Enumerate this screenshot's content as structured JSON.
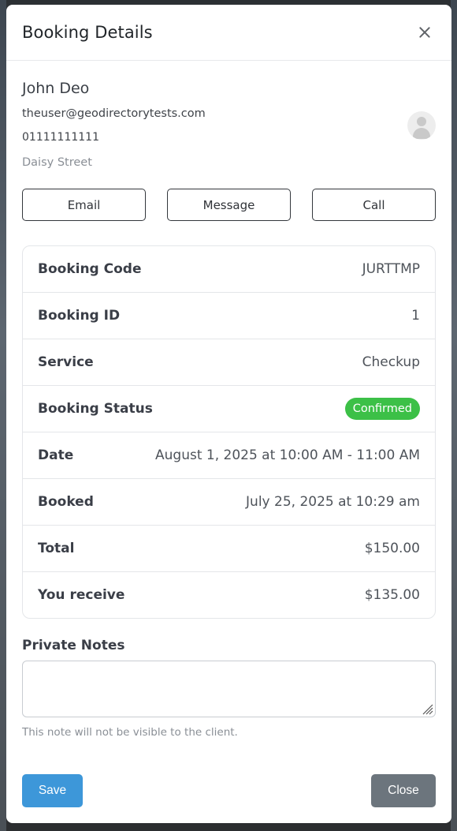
{
  "modal": {
    "title": "Booking Details",
    "close_icon": "close-icon"
  },
  "customer": {
    "name": "John Deo",
    "email": "theuser@geodirectorytests.com",
    "phone": "01111111111",
    "address": "Daisy Street",
    "avatar_icon": "user-avatar-icon"
  },
  "contact_buttons": {
    "email_label": "Email",
    "message_label": "Message",
    "call_label": "Call"
  },
  "details": [
    {
      "label": "Booking Code",
      "value": "JURTTMP"
    },
    {
      "label": "Booking ID",
      "value": "1"
    },
    {
      "label": "Service",
      "value": "Checkup"
    },
    {
      "label": "Booking Status",
      "value": "Confirmed",
      "badge_color": "#3cc047"
    },
    {
      "label": "Date",
      "value": "August 1, 2025 at 10:00 AM - 11:00 AM"
    },
    {
      "label": "Booked",
      "value": "July 25, 2025 at 10:29 am"
    },
    {
      "label": "Total",
      "value": "$150.00"
    },
    {
      "label": "You receive",
      "value": "$135.00"
    }
  ],
  "notes": {
    "label": "Private Notes",
    "value": "",
    "help_text": "This note will not be visible to the client."
  },
  "footer": {
    "save_label": "Save",
    "close_label": "Close",
    "save_color": "#3d97d9",
    "close_color": "#6c757d"
  }
}
